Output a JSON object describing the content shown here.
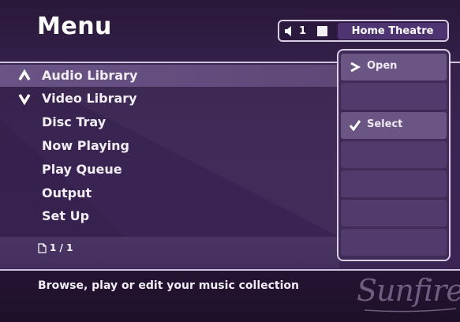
{
  "header": {
    "title": "Menu"
  },
  "zone": {
    "number": "1",
    "name": "Home Theatre"
  },
  "menu": {
    "items": [
      {
        "label": "Audio Library",
        "selected": true
      },
      {
        "label": "Video Library",
        "selected": false
      },
      {
        "label": "Disc Tray",
        "selected": false
      },
      {
        "label": "Now Playing",
        "selected": false
      },
      {
        "label": "Play Queue",
        "selected": false
      },
      {
        "label": "Output",
        "selected": false
      },
      {
        "label": "Set Up",
        "selected": false
      }
    ],
    "page_indicator": "1 / 1"
  },
  "actions": {
    "items": [
      {
        "label": "Open",
        "icon": "chevron-right-icon"
      },
      {
        "label": "",
        "icon": ""
      },
      {
        "label": "Select",
        "icon": "checkmark-icon"
      },
      {
        "label": "",
        "icon": ""
      },
      {
        "label": "",
        "icon": ""
      },
      {
        "label": "",
        "icon": ""
      },
      {
        "label": "",
        "icon": ""
      }
    ]
  },
  "status": {
    "description": "Browse, play or edit your music collection"
  },
  "brand": {
    "logo_text": "Sunfire"
  },
  "colors": {
    "background": "#3a2452",
    "selected_row": "#6a5385",
    "panel": "#3f2a58",
    "border": "#d9cfe4"
  }
}
